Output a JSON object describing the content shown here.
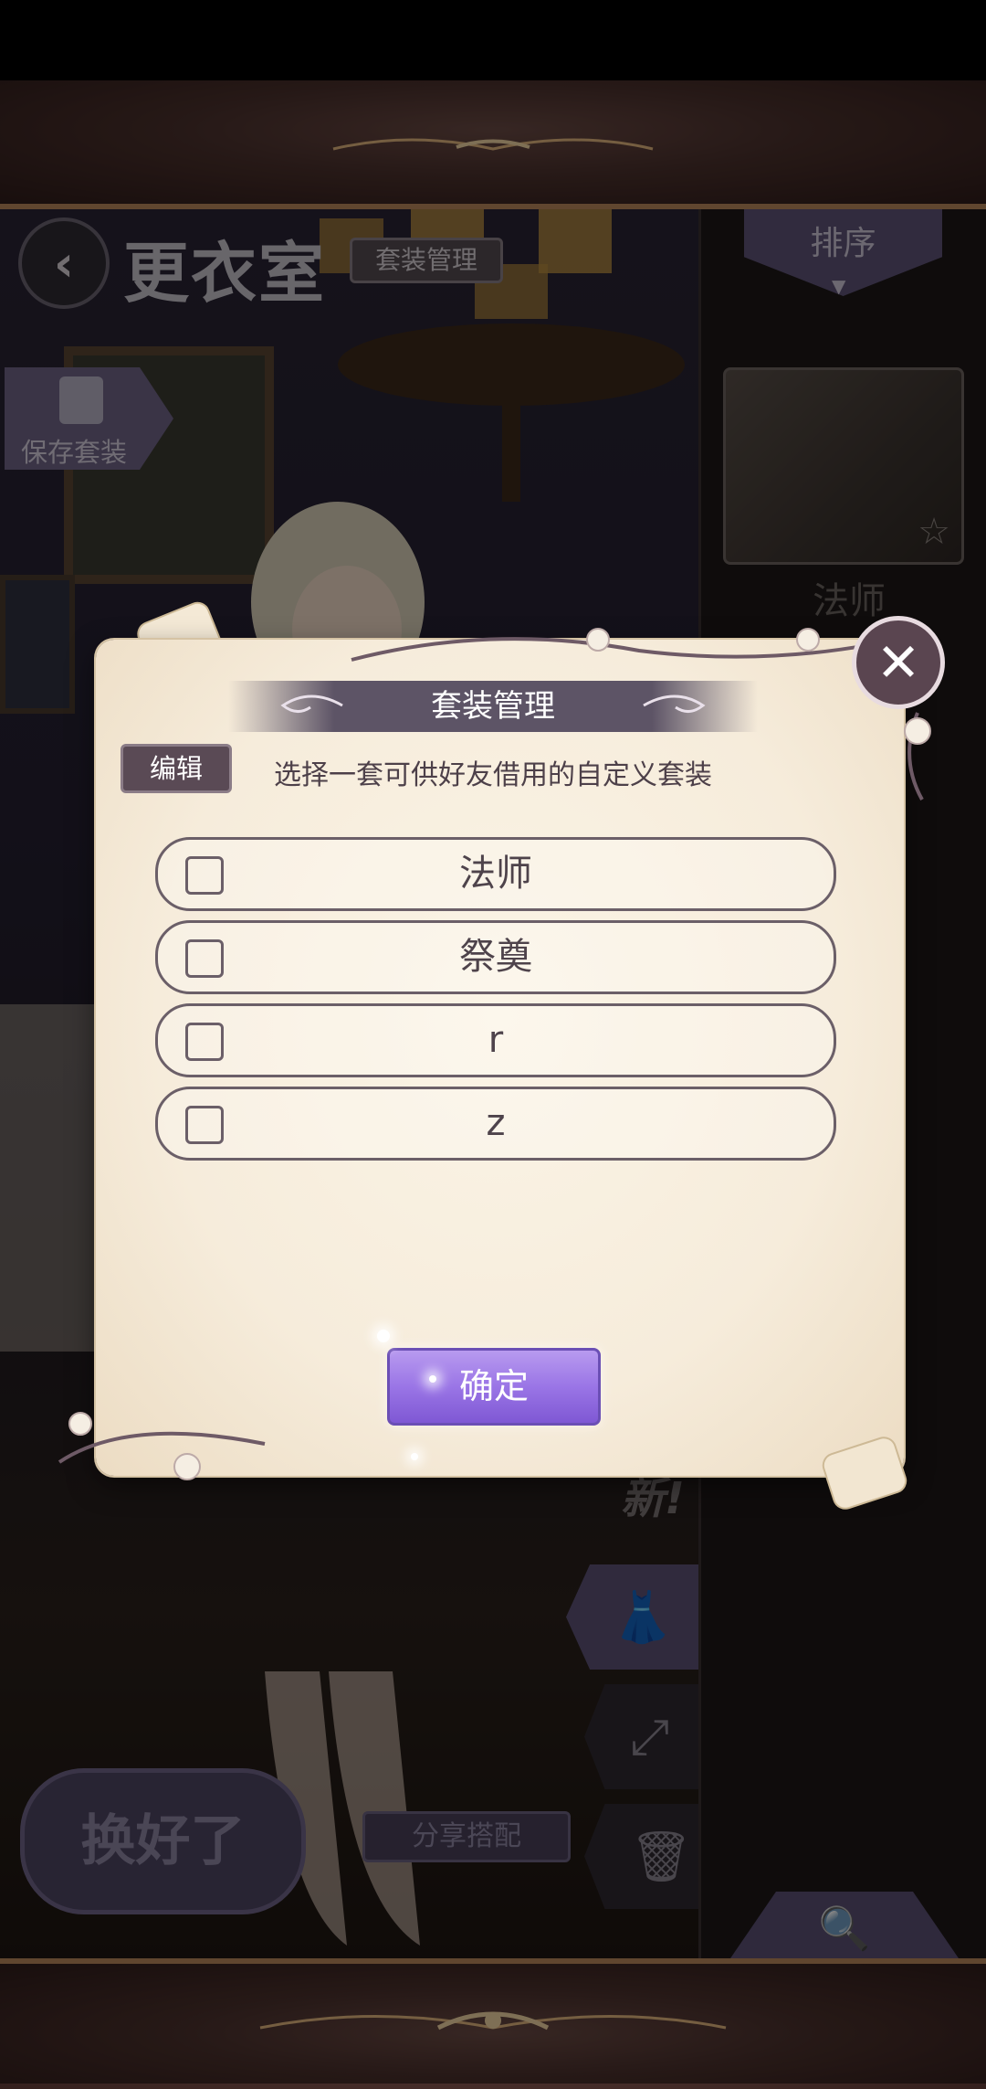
{
  "header": {
    "title": "更衣室",
    "suit_management_label": "套装管理"
  },
  "left_panel": {
    "save_suit_label": "保存套装"
  },
  "right_panel": {
    "sort_label": "排序",
    "suit_name": "法师"
  },
  "side_tools": {
    "new_label": "新!"
  },
  "bottom": {
    "done_label": "换好了",
    "share_label": "分享搭配"
  },
  "modal": {
    "title": "套装管理",
    "edit_label": "编辑",
    "hint": "选择一套可供好友借用的自定义套装",
    "options": [
      {
        "label": "法师",
        "checked": false
      },
      {
        "label": "祭奠",
        "checked": false
      },
      {
        "label": "r",
        "checked": false
      },
      {
        "label": "z",
        "checked": false
      }
    ],
    "confirm_label": "确定"
  },
  "colors": {
    "accent_purple": "#9a75e6",
    "parchment": "#f6ecdb",
    "frame_gold": "#b9875a"
  },
  "icons": [
    "back-icon",
    "close-icon",
    "dress-icon",
    "expand-icon",
    "trash-icon",
    "search-icon",
    "star-icon",
    "sort-arrow-icon"
  ]
}
